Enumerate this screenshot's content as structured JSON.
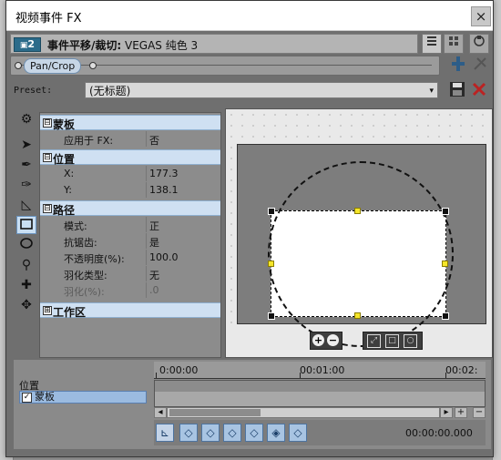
{
  "window": {
    "title": "视频事件 FX",
    "close": "×"
  },
  "chain": {
    "badge": "2",
    "title_prefix": "事件平移/裁切:",
    "title_rest": " VEGAS 纯色 3"
  },
  "plugin_tag": "Pan/Crop",
  "preset": {
    "label": "Preset:",
    "value": "(无标题)",
    "arrow": "▾"
  },
  "props": {
    "mask_section": "蒙板",
    "apply_fx_key": "应用于 FX:",
    "apply_fx_val": "否",
    "position_section": "位置",
    "x_key": "X:",
    "x_val": "177.3",
    "y_key": "Y:",
    "y_val": "138.1",
    "path_section": "路径",
    "mode_key": "模式:",
    "mode_val": "正",
    "antialias_key": "抗锯齿:",
    "antialias_val": "是",
    "opacity_key": "不透明度(%):",
    "opacity_val": "100.0",
    "feather_type_key": "羽化类型:",
    "feather_type_val": "无",
    "feather_key": "羽化(%):",
    "feather_val": ".0",
    "workspace_section": "工作区",
    "expand": "⊟",
    "collapse": "⊞"
  },
  "timeline": {
    "track_header": "位置",
    "track_item": "蒙板",
    "time0": "0:00:00",
    "time1": "00:01:00",
    "time2": "00:02:",
    "timecode": "00:00:00.000"
  },
  "icons": {
    "gear": "gear-icon",
    "arrow": "arrow-icon",
    "pen": "pen-icon",
    "pen-add": "pen-add-icon",
    "pen-remove": "pen-remove-icon",
    "split": "split-icon",
    "rect": "rectangle-icon",
    "ellipse": "ellipse-icon",
    "zoom": "zoom-icon",
    "normal-edit": "normal-edit-icon",
    "move": "move-icon"
  }
}
